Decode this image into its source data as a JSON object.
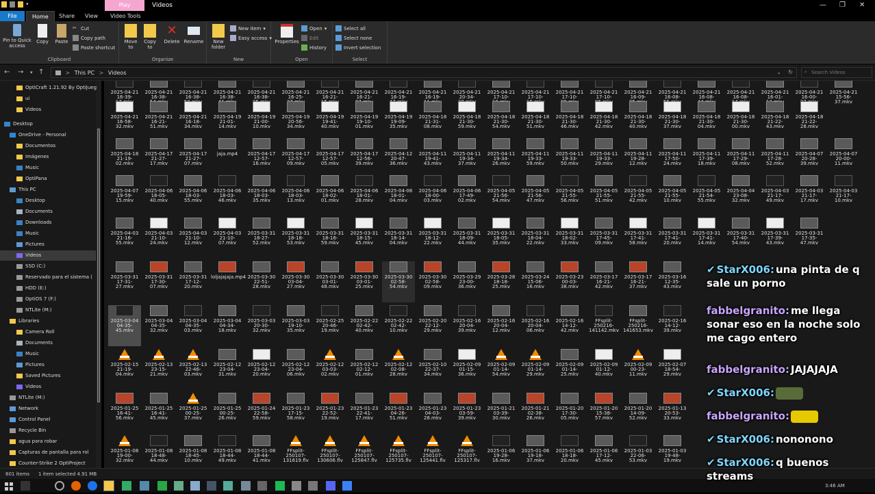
{
  "window": {
    "title": "Videos",
    "context_tab": "Play"
  },
  "ribbon_tabs": [
    "File",
    "Home",
    "Share",
    "View",
    "Video Tools"
  ],
  "ribbon": {
    "pin_label": "Pin to Quick access",
    "copy_label": "Copy",
    "paste_label": "Paste",
    "cut_label": "Cut",
    "copy_path_label": "Copy path",
    "paste_shortcut_label": "Paste shortcut",
    "clipboard_group": "Clipboard",
    "move_to_label": "Move to",
    "copy_to_label": "Copy to",
    "delete_label": "Delete",
    "rename_label": "Rename",
    "organize_group": "Organize",
    "new_folder_label": "New folder",
    "new_item_label": "New item",
    "easy_access_label": "Easy access",
    "new_group": "New",
    "properties_label": "Properties",
    "open_label": "Open",
    "edit_label": "Edit",
    "history_label": "History",
    "open_group": "Open",
    "select_all_label": "Select all",
    "select_none_label": "Select none",
    "invert_selection_label": "Invert selection",
    "select_group": "Select"
  },
  "address": {
    "crumb1": "This PC",
    "sep": ">",
    "crumb2": "Videos",
    "search_placeholder": "Search Videos"
  },
  "sidebar": [
    {
      "label": "OptiCraft 1.21.92 By OptiJueg",
      "icon": "folder-icon"
    },
    {
      "label": "ui",
      "icon": "folder-icon"
    },
    {
      "label": "Videos",
      "icon": "folder-icon"
    },
    {
      "label": "Desktop",
      "icon": "desktop-icon"
    },
    {
      "label": "OneDrive - Personal",
      "icon": "cloud-icon"
    },
    {
      "label": "Documentos",
      "icon": "folder-icon"
    },
    {
      "label": "Imágenes",
      "icon": "folder-icon"
    },
    {
      "label": "Music",
      "icon": "music-icon"
    },
    {
      "label": "OptiPana",
      "icon": "folder-icon"
    },
    {
      "label": "This PC",
      "icon": "pc-icon"
    },
    {
      "label": "Desktop",
      "icon": "desktop-icon"
    },
    {
      "label": "Documents",
      "icon": "document-icon"
    },
    {
      "label": "Downloads",
      "icon": "download-icon"
    },
    {
      "label": "Music",
      "icon": "music-icon"
    },
    {
      "label": "Pictures",
      "icon": "picture-icon"
    },
    {
      "label": "Videos",
      "icon": "video-icon"
    },
    {
      "label": "SSD (C:)",
      "icon": "drive-icon"
    },
    {
      "label": "Reservado para el sistema (",
      "icon": "drive-icon"
    },
    {
      "label": "HDD (E:)",
      "icon": "drive-icon"
    },
    {
      "label": "OptiOS 7 (F:)",
      "icon": "drive-icon"
    },
    {
      "label": "NTLite (M:)",
      "icon": "drive-icon"
    },
    {
      "label": "Libraries",
      "icon": "library-icon"
    },
    {
      "label": "Camera Roll",
      "icon": "folder-icon"
    },
    {
      "label": "Documents",
      "icon": "document-icon"
    },
    {
      "label": "Music",
      "icon": "music-icon"
    },
    {
      "label": "Pictures",
      "icon": "picture-icon"
    },
    {
      "label": "Saved Pictures",
      "icon": "folder-icon"
    },
    {
      "label": "Videos",
      "icon": "video-icon"
    },
    {
      "label": "NTLite (M:)",
      "icon": "drive-icon"
    },
    {
      "label": "Network",
      "icon": "network-icon"
    },
    {
      "label": "Control Panel",
      "icon": "control-panel-icon"
    },
    {
      "label": "Recycle Bin",
      "icon": "recycle-bin-icon"
    },
    {
      "label": "agua para robar",
      "icon": "folder-icon"
    },
    {
      "label": "Capturas de pantalla para rol",
      "icon": "folder-icon"
    },
    {
      "label": "Counter-Strike 2 OptiProject",
      "icon": "folder-icon"
    }
  ],
  "files": [
    [
      "2025-04-21 16-39-17.mkv",
      "2025-04-21 16-38-54.mkv",
      "2025-04-21 16-38-50.mkv",
      "2025-04-21 16-38-41.mkv",
      "2025-04-21 16-38-35.mkv",
      "2025-04-21 16-25-37.mkv",
      "2025-04-21 16-21-15.mkv",
      "2025-04-21 16-21-07.mkv",
      "2025-04-21 16-19-47.mkv",
      "2025-04-21 16-19-11.mkv",
      "2025-04-21 20-34-38.mkv",
      "2025-04-21 17-10-18.mkv",
      "2025-04-21 17-10-16.mkv",
      "2025-04-21 17-10-09.mkv",
      "2025-04-21 17-10-06.mkv",
      "2025-04-21 16-09-05.mkv",
      "2025-04-21 16-08-55.mkv",
      "2025-04-21 16-08-44.mkv",
      "2025-04-21 16-08-14.mkv",
      "2025-04-21 16-01-13.mkv",
      "2025-04-21 16-00-27.mkv",
      "2025-04-21 15-56-37.mkv"
    ],
    [
      "2025-04-21 16-58-32.mkv",
      "2025-04-21 16-21-51.mkv",
      "2025-04-21 16-18-34.mkv",
      "2025-04-19 21-01-14.mkv",
      "2025-04-19 21-00-10.mkv",
      "2025-04-19 20-56-34.mkv",
      "2025-04-19 19-41-40.mkv",
      "2025-04-19 19-10-01.mkv",
      "2025-04-19 19-09-35.mkv",
      "2025-04-18 21-31-08.mkv",
      "2025-04-18 21-30-59.mkv",
      "2025-04-18 21-30-54.mkv",
      "2025-04-18 21-30-51.mkv",
      "2025-04-18 21-30-46.mkv",
      "2025-04-18 21-30-42.mkv",
      "2025-04-18 21-30-40.mkv",
      "2025-04-18 21-30-37.mkv",
      "2025-04-18 21-30-04.mkv",
      "2025-04-18 21-30-00.mkv",
      "2025-04-18 21-22-43.mkv",
      "2025-04-18 21-22-28.mkv"
    ],
    [
      "2025-04-18 21-19-02.mkv",
      "2025-04-17 21-27-17.mkv",
      "2025-04-17 21-27-07.mkv",
      "jaja.mp4",
      "2025-04-17 12-57-16.mkv",
      "2025-04-17 12-57-09.mkv",
      "2025-04-17 12-57-05.mkv",
      "2025-04-17 12-56-39.mkv",
      "2025-04-12 20-47-36.mkv",
      "2025-04-11 19-41-43.mkv",
      "2025-04-11 19-34-37.mkv",
      "2025-04-11 19-34-26.mkv",
      "2025-04-11 19-33-59.mkv",
      "2025-04-11 19-33-50.mkv",
      "2025-04-11 19-33-29.mkv",
      "2025-04-11 19-28-12.mkv",
      "2025-04-11 17-50-24.mkv",
      "2025-04-11 17-39-18.mkv",
      "2025-04-11 17-29-08.mkv",
      "2025-04-11 17-28-52.mkv",
      "2025-04-07 20-28-39.mkv",
      "2025-04-07 20-00-11.mkv"
    ],
    [
      "2025-04-07 19-59-15.mkv",
      "2025-04-06 18-05-40.mkv",
      "2025-04-06 18-03-55.mkv",
      "2025-04-06 18-03-46.mkv",
      "2025-04-06 18-03-35.mkv",
      "2025-04-06 18-03-13.mkv",
      "2025-04-06 18-02-01.mkv",
      "2025-04-06 18-01-28.mkv",
      "2025-04-06 18-01-04.mkv",
      "2025-04-06 18-00-03.mkv",
      "2025-04-06 17-49-02.mkv",
      "2025-04-05 21-56-54.mkv",
      "2025-04-05 21-56-47.mkv",
      "2025-04-05 21-55-56.mkv",
      "2025-04-05 21-55-51.mkv",
      "2025-04-05 21-55-42.mkv",
      "2025-04-05 21-55-10.mkv",
      "2025-04-05 21-54-55.mkv",
      "2025-04-04 23-08-32.mkv",
      "2025-04-03 21-17-49.mkv",
      "2025-04-03 21-17-17.mkv",
      "2025-04-03 21-17-10.mkv"
    ],
    [
      "2025-04-03 21-16-55.mkv",
      "2025-04-03 21-10-24.mkv",
      "2025-04-03 21-10-12.mkv",
      "2025-04-03 21-10-07.mkv",
      "2025-03-31 18-27-52.mkv",
      "2025-03-31 18-18-53.mkv",
      "2025-03-31 18-16-59.mkv",
      "2025-03-31 18-15-45.mkv",
      "2025-03-31 18-14-04.mkv",
      "2025-03-31 18-12-22.mkv",
      "2025-03-31 18-09-44.mkv",
      "2025-03-31 18-05-35.mkv",
      "2025-03-31 18-04-22.mkv",
      "2025-03-31 18-02-33.mkv",
      "2025-03-31 17-45-09.mkv",
      "2025-03-31 17-41-58.mkv",
      "2025-03-31 17-41-20.mkv",
      "2025-03-31 17-41-14.mkv",
      "2025-03-31 17-40-54.mkv",
      "2025-03-31 17-39-43.mkv",
      "2025-03-31 17-35-47.mkv"
    ],
    [
      "2025-03-31 17-31-27.mkv",
      "2025-03-31 17-30-07.mkv",
      "2025-03-31 17-12-20.mkv",
      "loljajajaja.mp4",
      "2025-03-30 22-51-28.mkv",
      "2025-03-30 03-04-27.mkv",
      "2025-03-30 03-01-48.mkv",
      "2025-03-30 03-01-25.mkv",
      "2025-03-30 02-58-54.mkv",
      "2025-03-30 02-58-09.mkv",
      "2025-03-29 23-00-36.mkv",
      "2025-03-28 18-18-25.mkv",
      "2025-03-24 15-06-16.mkv",
      "2025-03-23 00-03-38.mkv",
      "2025-03-17 16-21-42.mkv",
      "2025-03-17 16-21-37.mkv",
      "2025-03-16 12-35-43.mkv"
    ],
    [
      "2025-03-04 04-35-45.mkv",
      "2025-03-04 04-35-32.mkv",
      "2025-03-04 04-35-03.mkv",
      "2025-03-04 04-34-18.mkv",
      "2025-03-03 20-30-32.mkv",
      "2025-03-03 19-10-35.mkv",
      "2025-02-25 20-46-19.mkv",
      "2025-02-22 02-42-40.mkv",
      "2025-02-22 02-42-10.mkv",
      "2025-02-20 22-12-29.mkv",
      "2025-02-16 20-04-39.mkv",
      "2025-02-16 20-04-12.mkv",
      "2025-02-16 20-04-06.mkv",
      "2025-02-16 14-12-42.mkv",
      "FFsplit-250216-141142.mkv",
      "FFsplit-250216-141653.mkv",
      "2025-02-16 14-12-39.mkv"
    ],
    [
      "2025-02-15 21-19-04.mkv",
      "2025-02-13 23-15-21.mkv",
      "2025-02-13 22-46-03.mkv",
      "2025-02-12 23-04-31.mkv",
      "2025-02-12 23-04-20.mkv",
      "2025-02-12 23-04-06.mkv",
      "2025-02-12 03-03-02.mkv",
      "2025-02-12 02-12-01.mkv",
      "2025-02-12 02-08-28.mkv",
      "2025-02-10 22-37-34.mkv",
      "2025-02-09 01-15-36.mkv",
      "2025-02-09 01-14-54.mkv",
      "2025-02-09 01-14-29.mkv",
      "2025-02-09 01-14-25.mkv",
      "2025-02-09 01-12-40.mkv",
      "2025-02-09 00-23-11.mkv",
      "2025-02-07 18-54-29.mkv"
    ],
    [
      "2025-01-25 16-41-56.mkv",
      "2025-01-25 16-41-45.mkv",
      "2025-01-25 00-25-37.mkv",
      "2025-01-25 00-25-26.mkv",
      "2025-01-24 22-58-59.mkv",
      "2025-01-23 17-15-58.mkv",
      "2025-01-23 22-52-19.mkv",
      "2025-01-23 22-41-17.mkv",
      "2025-01-23 04-26-51.mkv",
      "2025-01-23 04-03-28.mkv",
      "2025-01-23 03-59-39.mkv",
      "2025-01-21 03-39-30.mkv",
      "2025-01-21 02-38-26.mkv",
      "2025-01-20 17-30-05.mkv",
      "2025-01-20 15-38-57.mkv",
      "2025-01-20 14-09-52.mkv",
      "2025-01-13 20-53-33.mkv"
    ],
    [
      "2025-01-08 19-00-32.mkv",
      "2025-01-08 18-48-44.mkv",
      "2025-01-08 18-45-10.mkv",
      "2025-01-08 18-44-49.mkv",
      "2025-01-08 18-44-41.mkv",
      "FFsplit-250107-131619.flv",
      "FFsplit-250107-130606.flv",
      "FFsplit-250107-125847.flv",
      "FFsplit-250107-125735.flv",
      "FFsplit-250107-125441.flv",
      "FFsplit-250107-125317.flv",
      "2025-01-06 19-28-16.mkv",
      "2025-01-06 19-18-37.mkv",
      "2025-01-06 18-18-20.mkv",
      "2025-01-06 17-12-45.mkv",
      "2025-01-03 22-06-53.mkv",
      "2025-01-03 19-48-19.mkv"
    ]
  ],
  "status": {
    "count": "601 items",
    "selection": "1 item selected  4.91 MB"
  },
  "tray": {
    "time": "3:46 AM"
  },
  "chat": [
    {
      "user": "StarX006:",
      "text": "una pinta de q sale un porno"
    },
    {
      "user": "fabbelgranito:",
      "text": "me llega sonar eso en la noche solo me cago entero"
    },
    {
      "user": "fabbelgranito:",
      "text": "JAJAJAJA"
    },
    {
      "user": "StarX006:",
      "text": ""
    },
    {
      "user": "fabbelgranito:",
      "text": ""
    },
    {
      "user": "StarX006:",
      "text": "nononono"
    },
    {
      "user": "StarX006:",
      "text": "q buenos streams"
    }
  ],
  "colors": {
    "accent": "#1979ca",
    "play_tab": "#f5a6d0",
    "vlc": "#f28c00",
    "chat_user1": "#7fd6ff",
    "chat_user2": "#c9a6ff"
  }
}
